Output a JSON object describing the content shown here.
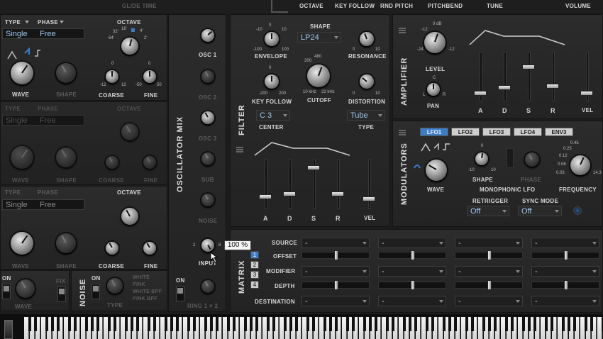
{
  "top_bar": {
    "glide_time": "GLIDE TIME",
    "octave": "OCTAVE",
    "key_follow": "KEY FOLLOW",
    "rnd_pitch": "RND PITCH",
    "pitchbend": "PITCHBEND",
    "tune": "TUNE",
    "volume": "VOLUME"
  },
  "osc1": {
    "type_label": "TYPE",
    "phase_label": "PHASE",
    "type_value": "Single",
    "phase_value": "Free",
    "octave_label": "OCTAVE",
    "octave_scale": [
      "32'",
      "16'",
      "8'",
      "4'",
      "2'",
      "64'"
    ],
    "wave_label": "WAVE",
    "shape_label": "SHAPE",
    "coarse_label": "COARSE",
    "fine_label": "FINE",
    "coarse_scale": [
      "-12",
      "-8",
      "-4",
      "0",
      "4",
      "8",
      "12"
    ],
    "fine_scale": [
      "-50",
      "-25",
      "0",
      "25",
      "50"
    ]
  },
  "osc2": {
    "type_label": "TYPE",
    "phase_label": "PHASE",
    "type_value": "Single",
    "phase_value": "Free",
    "octave_label": "OCTAVE",
    "wave_label": "WAVE",
    "shape_label": "SHAPE",
    "coarse_label": "COARSE",
    "fine_label": "FINE"
  },
  "osc3": {
    "type_label": "TYPE",
    "phase_label": "PHASE",
    "type_value": "Single",
    "phase_value": "Free",
    "octave_label": "OCTAVE",
    "wave_label": "WAVE",
    "shape_label": "SHAPE",
    "coarse_label": "COARSE",
    "fine_label": "FINE"
  },
  "bottom_left": {
    "on_label": "ON",
    "wave_label": "WAVE",
    "fix_label": "FIX",
    "noise_title": "NOISE",
    "noise_on": "ON",
    "noise_type_label": "TYPE",
    "noise_types": [
      "WHITE",
      "PINK",
      "WHITE BPF",
      "PINK BPF"
    ]
  },
  "osc_mix": {
    "title": "OSCILLATOR MIX",
    "channels": [
      "OSC 1",
      "OSC 2",
      "OSC 3",
      "SUB",
      "NOISE",
      "INPUT",
      "RING 1 × 2"
    ],
    "scale": [
      "0",
      "1",
      "2",
      "3",
      "4",
      "5",
      "6",
      "7",
      "8",
      "9",
      "10"
    ],
    "tooltip": "100 %",
    "on_label": "ON"
  },
  "filter": {
    "title": "FILTER",
    "shape_label": "SHAPE",
    "shape_value": "LP24",
    "envelope_label": "ENVELOPE",
    "resonance_label": "RESONANCE",
    "key_follow_label": "KEY FOLLOW",
    "cutoff_label": "CUTOFF",
    "distortion_label": "DISTORTION",
    "center_label": "CENTER",
    "center_value": "C 3",
    "type_label": "TYPE",
    "type_value": "Tube",
    "env_scale": [
      "-100",
      "-50",
      "-10",
      "0",
      "10",
      "50",
      "100"
    ],
    "res_scale": [
      "0",
      "2",
      "4",
      "6",
      "8",
      "10"
    ],
    "kf_scale": [
      "-200",
      "-100",
      "-50",
      "0",
      "50",
      "100",
      "150",
      "200"
    ],
    "cutoff_scale": [
      "20",
      "40",
      "100",
      "200",
      "480",
      "1k",
      "2k",
      "5k",
      "10 kHz",
      "22 kHz"
    ],
    "dist_scale": [
      "0",
      "2",
      "4",
      "6",
      "8",
      "10"
    ],
    "adsr": [
      "A",
      "D",
      "S",
      "R"
    ],
    "vel_label": "VEL",
    "adsr_levels": [
      0.22,
      0.28,
      0.88,
      0.28
    ],
    "vel_level": 0.18
  },
  "amplifier": {
    "title": "AMPLIFIER",
    "level_label": "LEVEL",
    "level_scale": [
      "-24",
      "-18",
      "-12",
      "-6",
      "0 dB",
      "-6",
      "-12"
    ],
    "pan_label": "PAN",
    "pan_scale": [
      "L",
      "C",
      "R"
    ],
    "adsr": [
      "A",
      "D",
      "S",
      "R"
    ],
    "vel_label": "VEL",
    "adsr_levels": [
      0.12,
      0.25,
      0.72,
      0.28
    ],
    "vel_level": 0.12
  },
  "modulators": {
    "title": "MODULATORS",
    "tabs": [
      "LFO1",
      "LFO2",
      "LFO3",
      "LFO4",
      "ENV3"
    ],
    "active_tab": "LFO1",
    "wave_label": "WAVE",
    "shape_label": "SHAPE",
    "shape_scale": [
      "-10",
      "-5",
      "0",
      "5",
      "10"
    ],
    "phase_label": "PHASE",
    "frequency_label": "FREQUENCY",
    "freq_scale": [
      "0.01",
      "0.03",
      "0.06",
      "0.12",
      "0.25",
      "0.45",
      "0.9",
      "1.8",
      "3.6",
      "7.2",
      "14.3"
    ],
    "mono_label": "MONOPHONIC LFO",
    "retrigger_label": "RETRIGGER",
    "retrigger_value": "Off",
    "sync_label": "SYNC MODE",
    "sync_value": "Off"
  },
  "matrix": {
    "title": "MATRIX",
    "slots": [
      "1",
      "2",
      "3",
      "4"
    ],
    "active_slot": "1",
    "rows": [
      "SOURCE",
      "OFFSET",
      "MODIFIER",
      "DEPTH",
      "DESTINATION"
    ],
    "source_values": [
      "-",
      "-",
      "-",
      "-"
    ],
    "modifier_values": [
      "-",
      "-",
      "-",
      "-"
    ],
    "destination_values": [
      "-",
      "-",
      "-",
      "-"
    ]
  },
  "colors": {
    "accent": "#3d7dc8",
    "text": "#d8d8d8",
    "panel": "#262626",
    "dim": "#5c5c5c"
  }
}
